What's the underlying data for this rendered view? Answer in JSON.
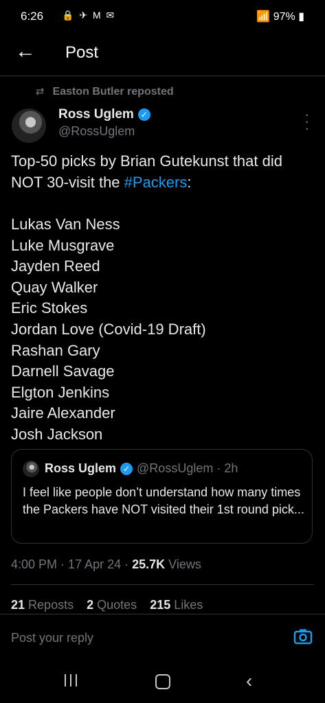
{
  "status_bar": {
    "time": "6:26",
    "left_icons": "🔒 ✈ M ✉",
    "battery": "97%",
    "signal_icons": "📶"
  },
  "header": {
    "title": "Post"
  },
  "repost": {
    "text": "Easton Butler reposted"
  },
  "tweet": {
    "author_name": "Ross Uglem",
    "author_handle": "@RossUglem",
    "text_part1": "Top-50 picks by Brian Gutekunst that did NOT 30-visit the ",
    "hashtag": "#Packers",
    "text_part2": ":",
    "picks": [
      "Lukas Van Ness",
      "Luke Musgrave",
      "Jayden Reed",
      "Quay Walker",
      "Eric Stokes",
      "Jordan Love (Covid-19 Draft)",
      "Rashan Gary",
      "Darnell Savage",
      "Elgton Jenkins",
      "Jaire Alexander",
      "Josh Jackson"
    ]
  },
  "quote": {
    "name": "Ross Uglem",
    "handle_time": "@RossUglem · 2h",
    "text": "I feel like people don’t understand how many times the Packers have NOT visited their 1st round pick..."
  },
  "meta": {
    "time_date": "4:00 PM · 17 Apr 24 · ",
    "views": "25.7K",
    "views_label": " Views"
  },
  "stats": {
    "reposts_count": "21",
    "reposts_label": "Reposts",
    "quotes_count": "2",
    "quotes_label": "Quotes",
    "likes_count": "215",
    "likes_label": "Likes"
  },
  "reply": {
    "placeholder": "Post your reply"
  },
  "colors": {
    "accent": "#1d9bf0",
    "muted": "#71767b",
    "text": "#e7e9ea",
    "background": "#000000"
  },
  "icons": [
    "back-arrow-icon",
    "repost-icon",
    "verified-icon",
    "more-icon",
    "camera-icon",
    "recents-icon",
    "home-icon",
    "nav-back-icon"
  ]
}
